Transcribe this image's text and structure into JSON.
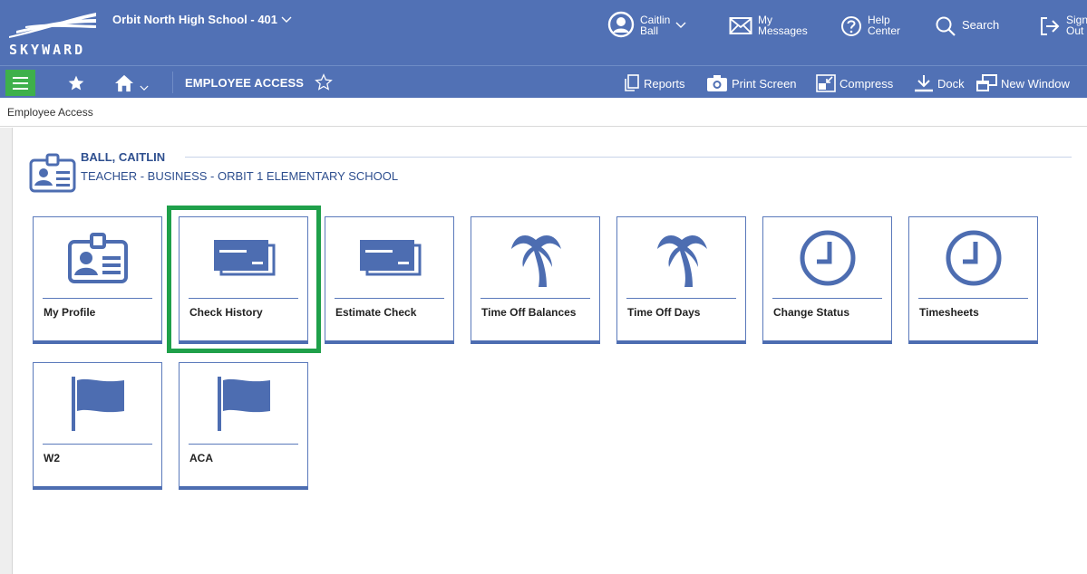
{
  "header": {
    "logo_text": "SKYWARD",
    "school": "Orbit North High School - 401",
    "user": {
      "line1": "Caitlin",
      "line2": "Ball"
    },
    "messages": {
      "line1": "My",
      "line2": "Messages"
    },
    "help": {
      "line1": "Help",
      "line2": "Center"
    },
    "search_label": "Search",
    "signout": {
      "line1": "Sign",
      "line2": "Out"
    }
  },
  "nav": {
    "page_title": "EMPLOYEE ACCESS",
    "actions": {
      "reports": "Reports",
      "print_screen": "Print Screen",
      "compress": "Compress",
      "dock": "Dock",
      "new_window": "New Window"
    }
  },
  "breadcrumb": "Employee Access",
  "employee": {
    "name": "BALL, CAITLIN",
    "role": "TEACHER - BUSINESS - ORBIT 1 ELEMENTARY SCHOOL"
  },
  "tiles": [
    {
      "label": "My Profile",
      "icon": "id-card-icon"
    },
    {
      "label": "Check History",
      "icon": "check-stack-icon"
    },
    {
      "label": "Estimate Check",
      "icon": "check-stack-icon"
    },
    {
      "label": "Time Off Balances",
      "icon": "palm-tree-icon"
    },
    {
      "label": "Time Off Days",
      "icon": "palm-tree-icon"
    },
    {
      "label": "Change Status",
      "icon": "clock-icon"
    },
    {
      "label": "Timesheets",
      "icon": "clock-icon"
    },
    {
      "label": "W2",
      "icon": "flag-icon"
    },
    {
      "label": "ACA",
      "icon": "flag-icon"
    }
  ],
  "colors": {
    "header_blue": "#5171b5",
    "menu_green": "#3eb04b",
    "highlight_green": "#1fa04a",
    "icon_blue": "#4d6db1"
  }
}
